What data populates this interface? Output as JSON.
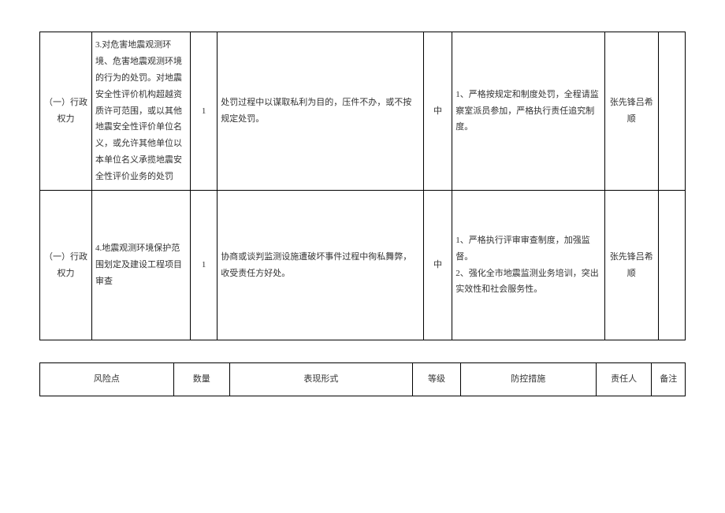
{
  "rows": [
    {
      "category": "（一）行政权力",
      "risk_point": "3.对危害地震观测环境、危害地震观测环境的行为的处罚。对地震安全性评价机构超越资质许可范围，或以其他地震安全性评价单位名义，或允许其他单位以本单位名义承揽地震安全性评价业务的处罚",
      "quantity": "1",
      "form": "处罚过程中以谋取私利为目的，压件不办，或不按规定处罚。",
      "level": "中",
      "measures": "1、严格按规定和制度处罚，全程请监察室派员参加，严格执行责任追究制度。",
      "person": "张先锋吕希顺",
      "remark": ""
    },
    {
      "category": "（一）行政权力",
      "risk_point": "4.地震观测环境保护范围划定及建设工程项目审查",
      "quantity": "1",
      "form": "协商或谈判监测设施遭破坏事件过程中徇私舞弊，收受责任方好处。",
      "level": "中",
      "measures": "1、严格执行评审审查制度，加强监督。\n2、强化全市地震监测业务培训，突出实效性和社会服务性。",
      "person": "张先锋吕希顺",
      "remark": ""
    }
  ],
  "header": {
    "risk_point": "风险点",
    "quantity": "数量",
    "form": "表现形式",
    "level": "等级",
    "measures": "防控措施",
    "person": "责任人",
    "remark": "备注"
  }
}
